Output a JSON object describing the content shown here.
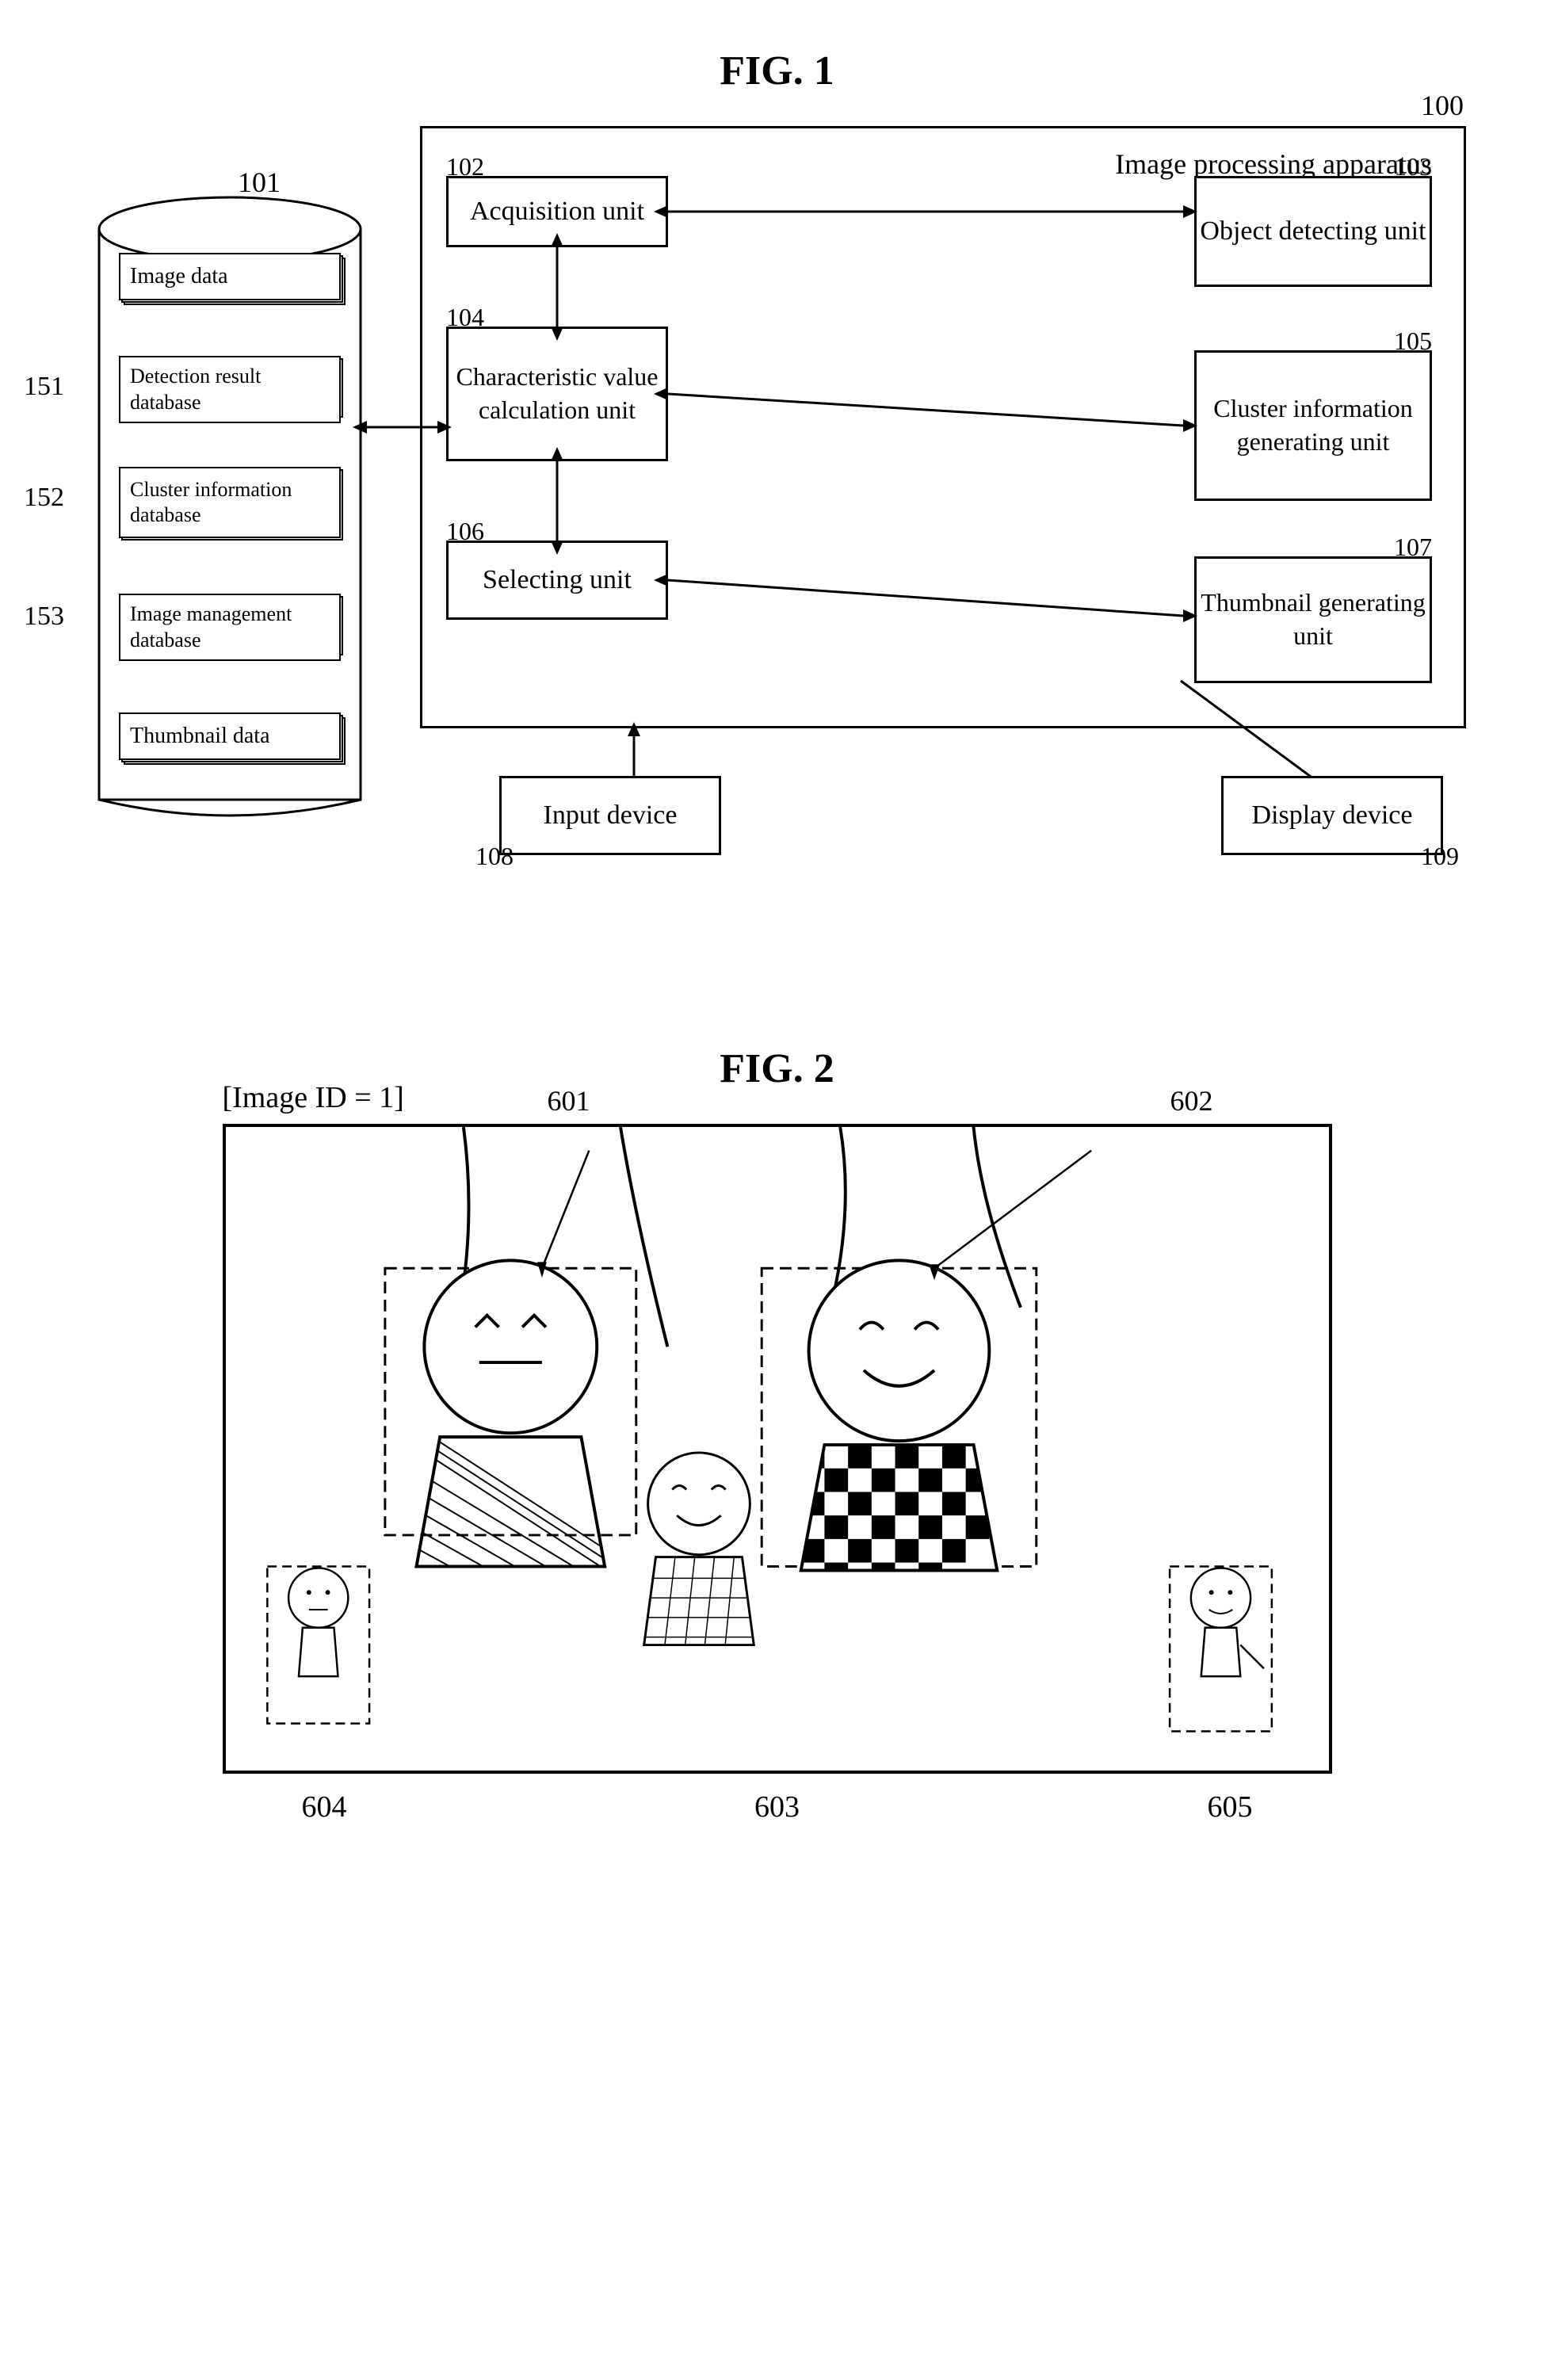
{
  "fig1": {
    "title": "FIG. 1",
    "label_100": "100",
    "label_101": "101",
    "label_102": "102",
    "label_103": "103",
    "label_104": "104",
    "label_105": "105",
    "label_106": "106",
    "label_107": "107",
    "label_108": "108",
    "label_109": "109",
    "label_151": "151",
    "label_152": "152",
    "label_153": "153",
    "apparatus_title": "Image processing apparatus",
    "unit_acquisition": "Acquisition unit",
    "unit_object_detecting": "Object detecting unit",
    "unit_char_value": "Characteristic value calculation unit",
    "unit_cluster": "Cluster information generating unit",
    "unit_selecting": "Selecting unit",
    "unit_thumbnail": "Thumbnail generating unit",
    "unit_input": "Input device",
    "unit_display": "Display device",
    "db_image_data": "Image data",
    "db_detection_result": "Detection result database",
    "db_cluster_info": "Cluster information database",
    "db_image_mgmt": "Image management database",
    "db_thumbnail": "Thumbnail data"
  },
  "fig2": {
    "title": "FIG. 2",
    "image_id_label": "[Image ID = 1]",
    "label_601": "601",
    "label_602": "602",
    "label_603": "603",
    "label_604": "604",
    "label_605": "605"
  }
}
